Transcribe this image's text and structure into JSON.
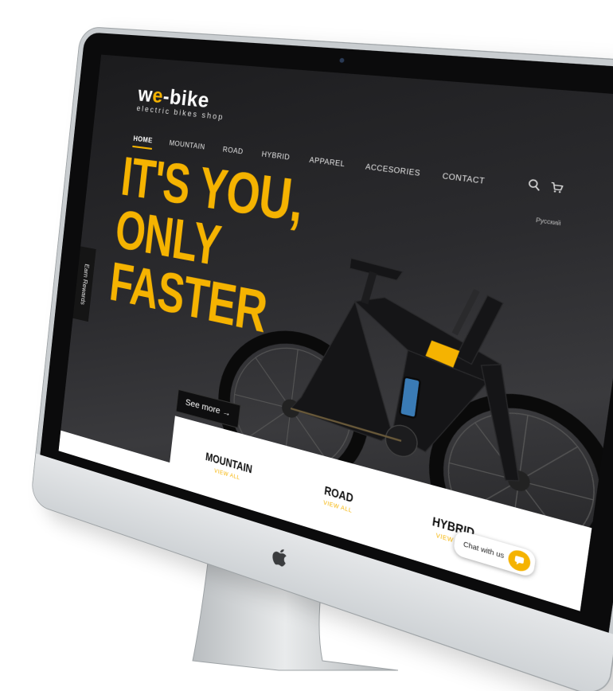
{
  "site": {
    "logo_main_prefix": "w",
    "logo_main_e": "e",
    "logo_main_suffix": "-bike",
    "logo_subtitle": "electric bikes shop"
  },
  "nav": {
    "items": [
      {
        "label": "HOME",
        "active": true
      },
      {
        "label": "MOUNTAIN"
      },
      {
        "label": "ROAD"
      },
      {
        "label": "HYBRID"
      },
      {
        "label": "APPAREL"
      },
      {
        "label": "ACCESORIES"
      },
      {
        "label": "CONTACT"
      }
    ]
  },
  "header_icons": [
    "search-icon",
    "cart-icon"
  ],
  "language": "Русский",
  "hero": {
    "line1": "IT'S YOU,",
    "line2": "ONLY FASTER",
    "cta": "See more →"
  },
  "side_tab": "Earn Rewards",
  "categories": [
    {
      "title": "MOUNTAIN",
      "link": "VIEW ALL"
    },
    {
      "title": "ROAD",
      "link": "VIEW ALL"
    },
    {
      "title": "HYBRID",
      "link": "VIEW ALL"
    }
  ],
  "chat": {
    "label": "Chat with us"
  },
  "colors": {
    "accent": "#f5b301",
    "screen_bg": "#2b2b2e",
    "frame": "#c9cdd0"
  }
}
